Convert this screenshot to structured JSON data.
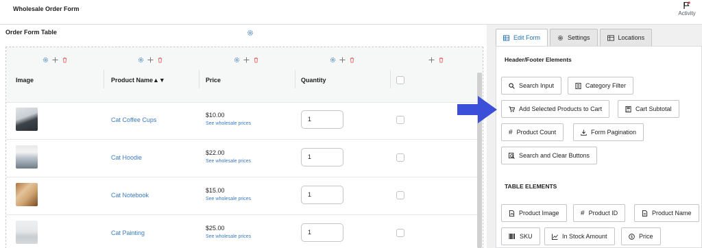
{
  "topbar": {
    "title": "Wholesale Order Form",
    "activity_label": "Activity"
  },
  "left": {
    "header": "Order Form Table",
    "columns": [
      {
        "label": "Image"
      },
      {
        "label": "Product Name▲▼"
      },
      {
        "label": "Price"
      },
      {
        "label": "Quantity"
      }
    ],
    "rows": [
      {
        "name": "Cat Coffee Cups",
        "price": "$10.00",
        "wholesale_link": "See wholesale prices",
        "qty": "1"
      },
      {
        "name": "Cat Hoodie",
        "price": "$22.00",
        "wholesale_link": "See wholesale prices",
        "qty": "1"
      },
      {
        "name": "Cat Notebook",
        "price": "$15.00",
        "wholesale_link": "See wholesale prices",
        "qty": "1"
      },
      {
        "name": "Cat Painting",
        "price": "$25.00",
        "wholesale_link": "See wholesale prices",
        "qty": "1"
      }
    ]
  },
  "tabs": [
    {
      "label": "Edit Form",
      "icon": "table-icon",
      "active": true
    },
    {
      "label": "Settings",
      "icon": "gear-icon",
      "active": false
    },
    {
      "label": "Locations",
      "icon": "location-table-icon",
      "active": false
    }
  ],
  "panel": {
    "header_footer_title": "Header/Footer Elements",
    "header_footer": [
      {
        "label": "Search Input",
        "icon": "search-icon"
      },
      {
        "label": "Category Filter",
        "icon": "list-icon"
      },
      {
        "label": "Add Selected Products to Cart",
        "icon": "cart-icon"
      },
      {
        "label": "Cart Subtotal",
        "icon": "calc-icon"
      },
      {
        "label": "Product Count",
        "icon": "hash-icon"
      },
      {
        "label": "Form Pagination",
        "icon": "download-icon"
      },
      {
        "label": "Search and Clear Buttons",
        "icon": "search-clear-icon"
      }
    ],
    "table_title": "TABLE ELEMENTS",
    "table_elements": [
      {
        "label": "Product Image",
        "icon": "image-icon"
      },
      {
        "label": "Product ID",
        "icon": "hash-icon"
      },
      {
        "label": "Product Name",
        "icon": "doc-icon"
      },
      {
        "label": "SKU",
        "icon": "barcode-icon"
      },
      {
        "label": "In Stock Amount",
        "icon": "chart-icon"
      },
      {
        "label": "Price",
        "icon": "dollar-icon"
      }
    ]
  },
  "colors": {
    "accent": "#2271b1",
    "link": "#3a7bbf",
    "arrow": "#3b4fd8",
    "delete": "#e26464"
  }
}
